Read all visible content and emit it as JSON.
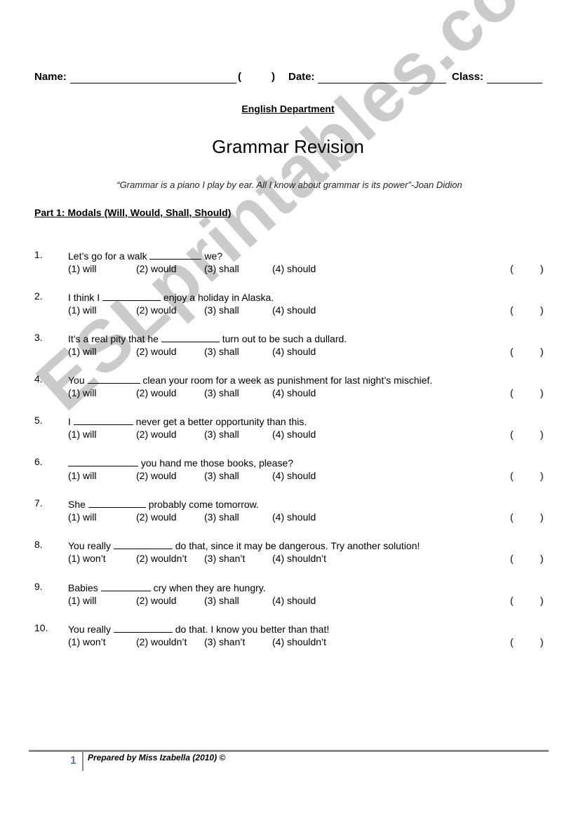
{
  "header": {
    "name_label": "Name:",
    "paren_open": "(",
    "paren_close": ")",
    "date_label": "Date:",
    "class_label": "Class:"
  },
  "department": "English Department",
  "title": "Grammar Revision",
  "quote": "“Grammar is a piano I play by ear. All I know about grammar is its power”-Joan Didion",
  "part_heading": "Part 1: Modals (Will, Would, Shall, Should)",
  "answer_box": {
    "open": "(",
    "close": ")"
  },
  "questions": [
    {
      "number": "1.",
      "before": "Let’s go for a walk ",
      "after": " we?",
      "options": [
        "(1) will",
        "(2) would",
        "(3) shall",
        "(4) should"
      ]
    },
    {
      "number": "2.",
      "before": "I think I ",
      "after": " enjoy a holiday in Alaska.",
      "options": [
        "(1) will",
        "(2) would",
        "(3) shall",
        "(4) should"
      ]
    },
    {
      "number": "3.",
      "before": "It’s a real pity that he ",
      "after": " turn out to be such a dullard.",
      "options": [
        "(1) will",
        "(2) would",
        "(3) shall",
        "(4) should"
      ]
    },
    {
      "number": "4.",
      "before": "You ",
      "after": " clean your room for a week as punishment for last night’s mischief.",
      "options": [
        "(1) will",
        "(2) would",
        "(3) shall",
        "(4) should"
      ]
    },
    {
      "number": "5.",
      "before": "I ",
      "after": " never get a better opportunity than this.",
      "options": [
        "(1) will",
        "(2) would",
        "(3) shall",
        "(4) should"
      ]
    },
    {
      "number": "6.",
      "before": "",
      "after": " you hand me those books, please?",
      "options": [
        "(1) will",
        "(2) would",
        "(3) shall",
        "(4) should"
      ]
    },
    {
      "number": "7.",
      "before": "She ",
      "after": " probably come tomorrow.",
      "options": [
        "(1) will",
        "(2) would",
        "(3) shall",
        "(4) should"
      ]
    },
    {
      "number": "8.",
      "before": "You really ",
      "after": " do that, since it may be dangerous. Try another solution!",
      "options": [
        "(1) won’t",
        "(2) wouldn’t",
        "(3) shan’t",
        "(4) shouldn’t"
      ]
    },
    {
      "number": "9.",
      "before": "Babies ",
      "after": " cry when they are hungry.",
      "options": [
        "(1) will",
        "(2) would",
        "(3) shall",
        "(4) should"
      ]
    },
    {
      "number": "10.",
      "before": "You really ",
      "after": " do that. I know you better than that!",
      "options": [
        "(1) won’t",
        "(2) wouldn’t",
        "(3) shan’t",
        "(4) shouldn’t"
      ]
    }
  ],
  "watermark": "ESLprintables.com",
  "footer": {
    "page_number": "1",
    "text": "Prepared by Miss Izabella (2010) ©"
  },
  "colors": {
    "page_number": "#5a7fa5",
    "footer_rule": "#8a8a8a",
    "watermark": "#a0a0a0"
  }
}
